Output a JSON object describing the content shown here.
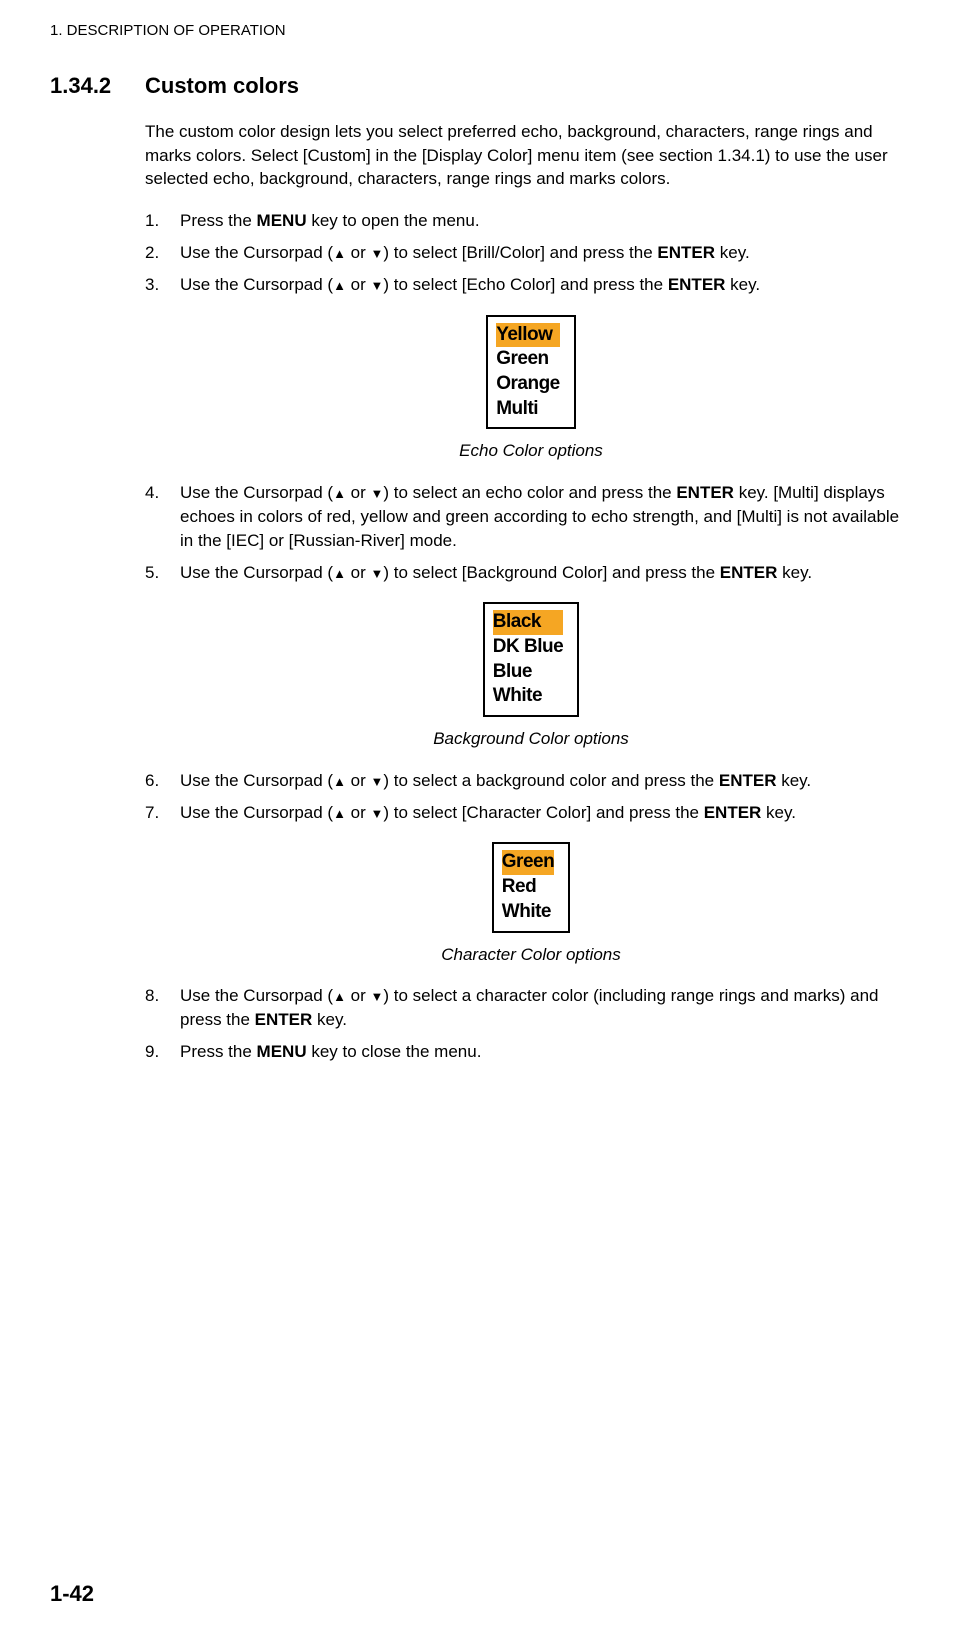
{
  "header": "1.  DESCRIPTION OF OPERATION",
  "section": {
    "number": "1.34.2",
    "title": "Custom colors"
  },
  "intro": "The custom color design lets you select preferred echo, background, characters, range rings and marks colors. Select [Custom] in the [Display Color] menu item (see section 1.34.1) to use the user selected echo, background, characters, range rings and marks colors.",
  "steps": {
    "s1": {
      "num": "1.",
      "pre": "Press the ",
      "key1": "MENU",
      "post": " key to open the menu."
    },
    "s2": {
      "num": "2.",
      "pre": "Use the Cursorpad (",
      "mid": " or ",
      "post1": ") to select [Brill/Color] and press the ",
      "key1": "ENTER",
      "post2": " key."
    },
    "s3": {
      "num": "3.",
      "pre": "Use the Cursorpad (",
      "mid": " or ",
      "post1": ") to select [Echo Color] and press the ",
      "key1": "ENTER",
      "post2": " key."
    },
    "s4": {
      "num": "4.",
      "pre": "Use the Cursorpad (",
      "mid": " or ",
      "post1": ") to select an echo color and press the ",
      "key1": "ENTER",
      "post2": " key. [Multi] displays echoes in colors of red, yellow and green according to echo strength, and [Multi] is not available in the [IEC] or [Russian-River] mode."
    },
    "s5": {
      "num": "5.",
      "pre": "Use the Cursorpad (",
      "mid": " or ",
      "post1": ") to select [Background Color] and press the ",
      "key1": "ENTER",
      "post2": " key."
    },
    "s6": {
      "num": "6.",
      "pre": "Use the Cursorpad (",
      "mid": " or ",
      "post1": ") to select a background color and press the ",
      "key1": "ENTER",
      "post2": " key."
    },
    "s7": {
      "num": "7.",
      "pre": "Use the Cursorpad (",
      "mid": " or ",
      "post1": ") to select [Character Color] and press the ",
      "key1": "ENTER",
      "post2": " key."
    },
    "s8": {
      "num": "8.",
      "pre": "Use the Cursorpad (",
      "mid": " or ",
      "post1": ") to select a character color (including range rings and marks) and press the ",
      "key1": "ENTER",
      "post2": " key."
    },
    "s9": {
      "num": "9.",
      "pre": "Press the ",
      "key1": "MENU",
      "post": " key to close the menu."
    }
  },
  "echoBox": {
    "items": [
      "Yellow",
      "Green",
      "Orange",
      "Multi"
    ],
    "caption": "Echo Color options"
  },
  "bgBox": {
    "items": [
      "Black",
      "DK Blue",
      "Blue",
      "White"
    ],
    "caption": "Background Color options"
  },
  "charBox": {
    "items": [
      "Green",
      "Red",
      "White"
    ],
    "caption": "Character Color options"
  },
  "pageNum": "1-42"
}
